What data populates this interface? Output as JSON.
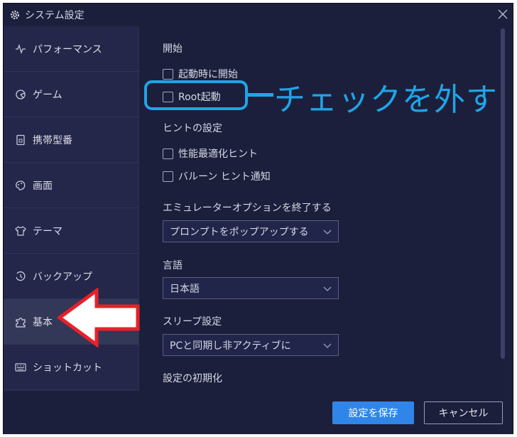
{
  "window": {
    "title": "システム設定"
  },
  "sidebar": {
    "items": [
      {
        "label": "パフォーマンス",
        "icon": "pulse-icon"
      },
      {
        "label": "ゲーム",
        "icon": "pie-icon"
      },
      {
        "label": "携帯型番",
        "icon": "phone-icon"
      },
      {
        "label": "画面",
        "icon": "palette-icon"
      },
      {
        "label": "テーマ",
        "icon": "shirt-icon"
      },
      {
        "label": "バックアップ",
        "icon": "history-icon"
      },
      {
        "label": "基本",
        "icon": "puzzle-icon",
        "active": true
      },
      {
        "label": "ショットカット",
        "icon": "keyboard-icon"
      }
    ]
  },
  "content": {
    "startup": {
      "heading": "開始",
      "launch_on_boot": {
        "label": "起動時に開始",
        "checked": false
      },
      "root_boot": {
        "label": "Root起動",
        "checked": false
      }
    },
    "hints": {
      "heading": "ヒントの設定",
      "perf_hint": {
        "label": "性能最適化ヒント",
        "checked": false
      },
      "balloon_hint": {
        "label": "バルーン ヒント通知",
        "checked": false
      }
    },
    "exit_option": {
      "heading": "エミュレーターオプションを終了する",
      "selected": "プロンプトをポップアップする"
    },
    "language": {
      "heading": "言語",
      "selected": "日本語"
    },
    "sleep": {
      "heading": "スリープ設定",
      "selected": "PCと同期し非アクティブに"
    },
    "reset": {
      "heading": "設定の初期化"
    }
  },
  "footer": {
    "save_label": "設定を保存",
    "cancel_label": "キャンセル"
  },
  "annotation": {
    "text": "チェックを外す",
    "color": "#1ea5e8",
    "arrow_color": "#e8202a"
  },
  "colors": {
    "window_bg": "#1c1f3b",
    "sidebar_bg": "#24274a",
    "active_item_bg": "#333758",
    "primary_button": "#2f86e8"
  }
}
